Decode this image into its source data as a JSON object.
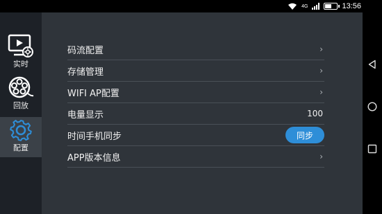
{
  "status_bar": {
    "time": "13:56",
    "network_label": "4G"
  },
  "nav": {
    "items": [
      {
        "label": "实时",
        "icon": "monitor-play-icon",
        "active": false
      },
      {
        "label": "回放",
        "icon": "film-reel-icon",
        "active": false
      },
      {
        "label": "配置",
        "icon": "gear-icon",
        "active": true
      }
    ]
  },
  "settings": {
    "rows": [
      {
        "label": "码流配置",
        "type": "chevron"
      },
      {
        "label": "存储管理",
        "type": "chevron"
      },
      {
        "label": "WIFI AP配置",
        "type": "chevron"
      },
      {
        "label": "电量显示",
        "type": "value",
        "value": "100"
      },
      {
        "label": "时间手机同步",
        "type": "button",
        "button_label": "同步"
      },
      {
        "label": "APP版本信息",
        "type": "chevron"
      }
    ],
    "chevron_glyph": "›"
  },
  "system_nav": [
    "back-triangle-icon",
    "home-circle-icon",
    "recents-square-icon"
  ],
  "colors": {
    "accent": "#2e8ed8",
    "content_bg": "#2f343a",
    "nav_bg": "#1d2127",
    "nav_active_bg": "#3b4148"
  }
}
